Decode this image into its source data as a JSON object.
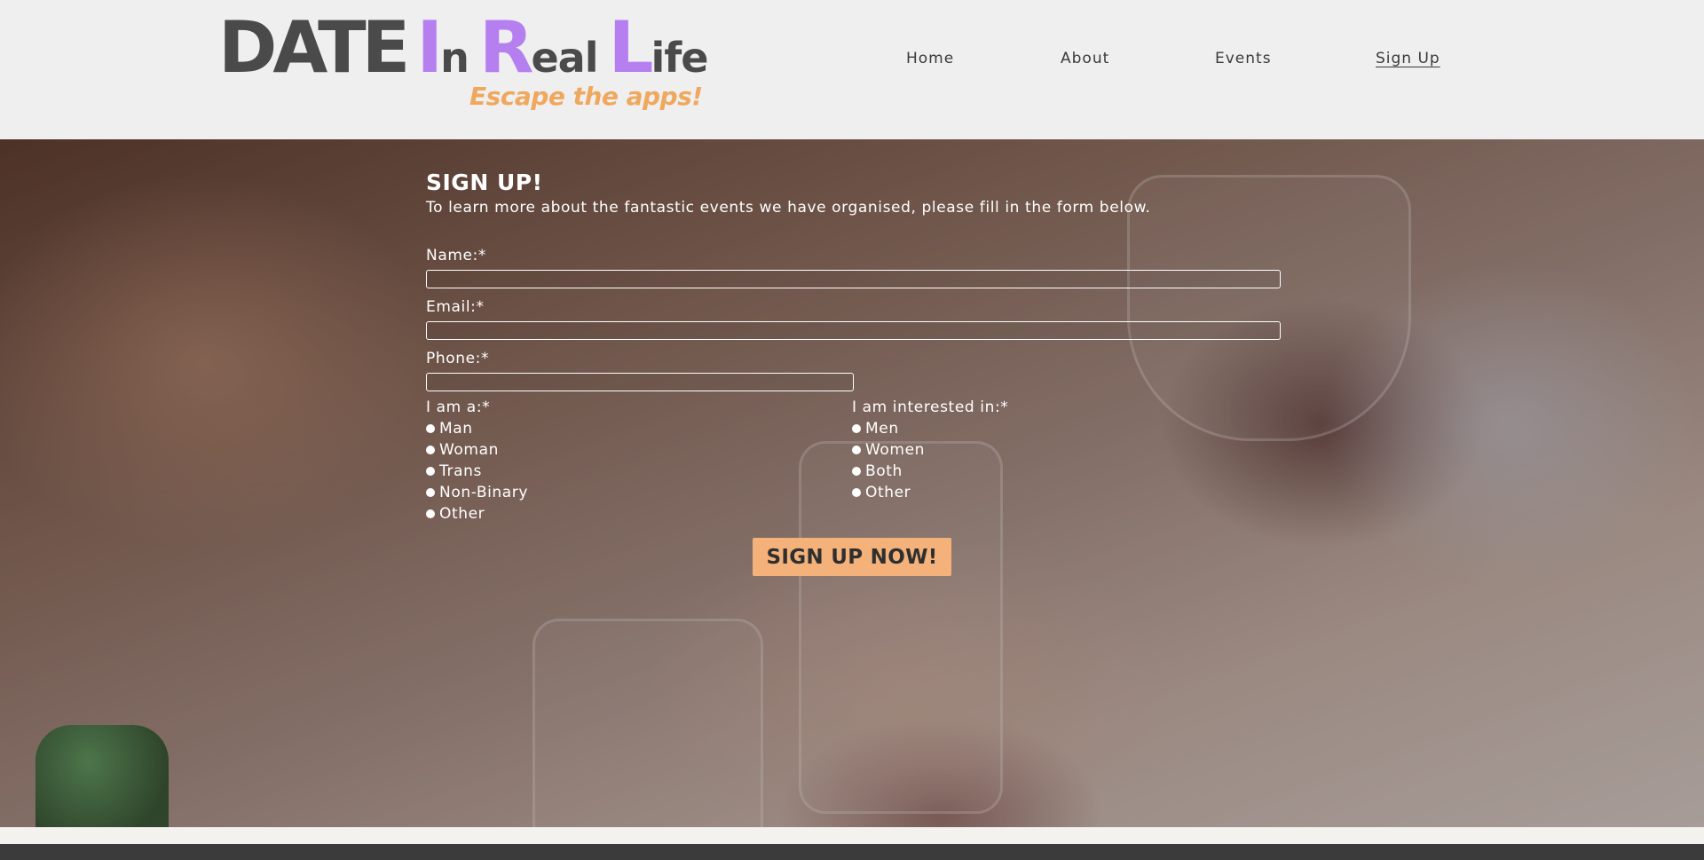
{
  "brand": {
    "date": "DATE",
    "in_big": "I",
    "in_small": "n",
    "real_big": "R",
    "real_small": "eal",
    "life_big": "L",
    "life_small": "ife",
    "tagline": "Escape the apps!",
    "colors": {
      "dark": "#4a4a4a",
      "purple": "#b57ff0",
      "orange": "#f0a75e"
    }
  },
  "nav": {
    "items": [
      {
        "label": "Home"
      },
      {
        "label": "About"
      },
      {
        "label": "Events"
      },
      {
        "label": "Sign Up",
        "active": true
      }
    ]
  },
  "form": {
    "title": "SIGN UP!",
    "intro": "To learn more about the fantastic events we have organised, please fill in the form below.",
    "name_label": "Name:*",
    "name_value": "",
    "email_label": "Email:*",
    "email_value": "",
    "phone_label": "Phone:*",
    "phone_value": "",
    "iam": {
      "label": "I am a:*",
      "options": [
        "Man",
        "Woman",
        "Trans",
        "Non-Binary",
        "Other"
      ]
    },
    "interested": {
      "label": "I am interested in:*",
      "options": [
        "Men",
        "Women",
        "Both",
        "Other"
      ]
    },
    "submit_label": "SIGN UP NOW!",
    "button_color": "#f4b27a"
  }
}
